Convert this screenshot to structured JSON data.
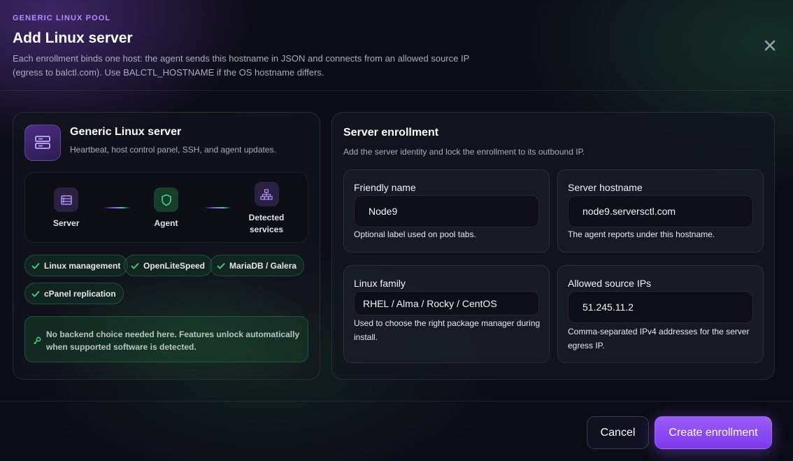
{
  "dialog": {
    "eyebrow": "GENERIC LINUX POOL",
    "title": "Add Linux server",
    "subtitle": "Each enrollment binds one host: the agent sends this hostname in JSON and connects from an allowed source IP (egress to balctl.com). Use BALCTL_HOSTNAME if the OS hostname differs.",
    "close_icon": "close-icon"
  },
  "server_card": {
    "icon": "server-icon",
    "title": "Generic Linux server",
    "subtitle": "Heartbeat, host control panel, SSH, and agent updates.",
    "flow": [
      {
        "label": "Server",
        "icon": "server-icon"
      },
      {
        "label": "Agent",
        "icon": "shield-icon"
      },
      {
        "label": "Detected services",
        "icon": "network-icon"
      }
    ],
    "features": [
      "Linux management",
      "OpenLiteSpeed",
      "MariaDB / Galera",
      "cPanel replication"
    ],
    "notice": "No backend choice needed here. Features unlock automatically when supported software is detected."
  },
  "enrollment": {
    "title": "Server enrollment",
    "subtitle": "Add the server identity and lock the enrollment to its outbound IP.",
    "friendly_name": {
      "label": "Friendly name",
      "value": "Node9",
      "help": "Optional label used on pool tabs."
    },
    "hostname": {
      "label": "Server hostname",
      "value": "node9.serversctl.com",
      "help": "The agent reports under this hostname."
    },
    "linux_family": {
      "label": "Linux family",
      "value": "RHEL / Alma / Rocky / CentOS",
      "help": "Used to choose the right package manager during install."
    },
    "allowed_ips": {
      "label": "Allowed source IPs",
      "value": "51.245.11.2",
      "help": "Comma-separated IPv4 addresses for the server egress IP."
    }
  },
  "footer": {
    "cancel_label": "Cancel",
    "create_label": "Create enrollment"
  },
  "colors": {
    "accent": "#9b5cf6",
    "success": "#3fd68a",
    "background": "#0c0c16"
  }
}
